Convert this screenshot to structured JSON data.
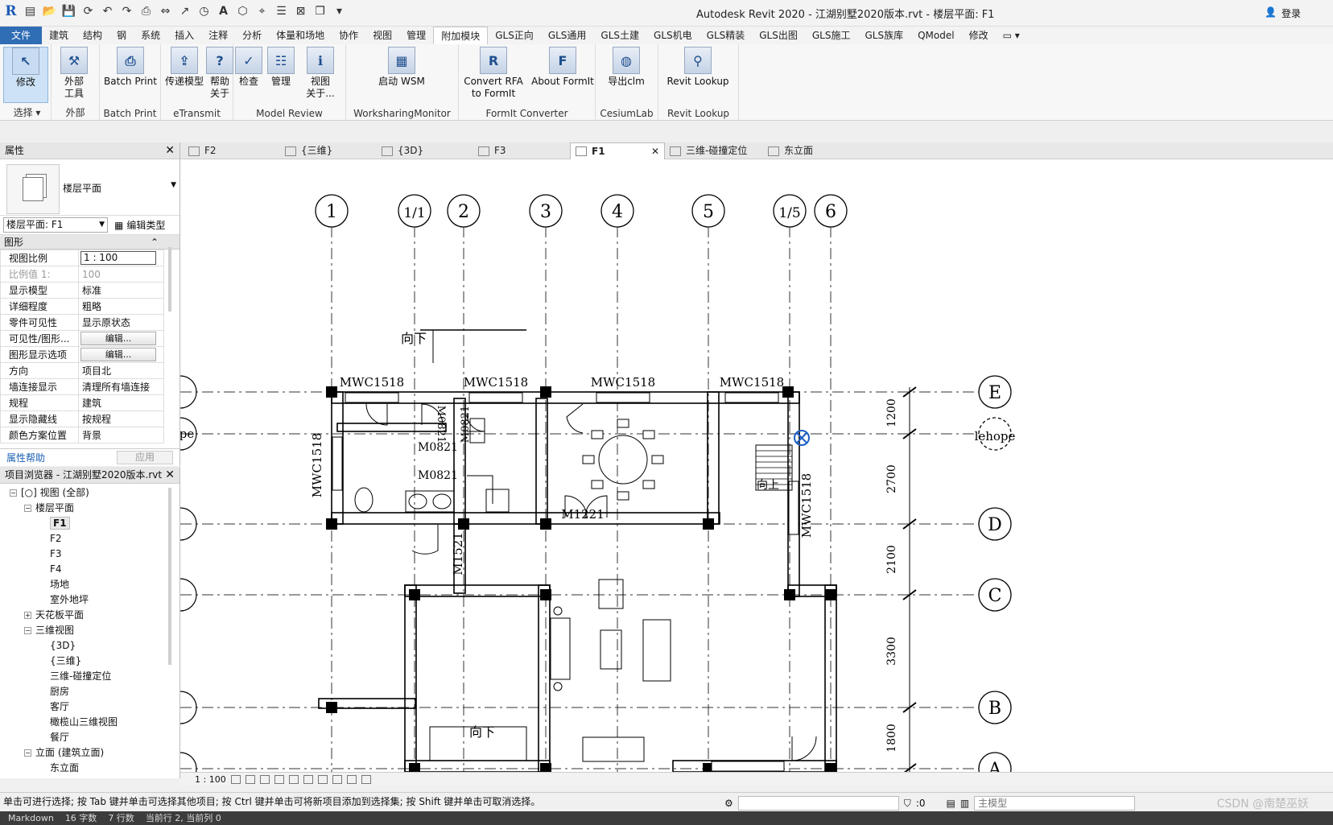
{
  "app": {
    "title": "Autodesk Revit 2020 - 江湖别墅2020版本.rvt - 楼层平面: F1",
    "signin": "登录",
    "logo": "R"
  },
  "menu": [
    "文件",
    "建筑",
    "结构",
    "钢",
    "系统",
    "插入",
    "注释",
    "分析",
    "体量和场地",
    "协作",
    "视图",
    "管理",
    "附加模块",
    "GLS正向",
    "GLS通用",
    "GLS土建",
    "GLS机电",
    "GLS精装",
    "GLS出图",
    "GLS施工",
    "GLS族库",
    "QModel",
    "修改"
  ],
  "menu_active": "附加模块",
  "ribbon": {
    "groups": [
      {
        "title": "选择 ▾",
        "buttons": [
          {
            "label": "修改",
            "icon": "cursor-icon"
          }
        ]
      },
      {
        "title": "外部",
        "buttons": [
          {
            "label": "外部\n工具",
            "icon": "tools-icon"
          }
        ]
      },
      {
        "title": "Batch Print",
        "buttons": [
          {
            "label": "Batch Print",
            "icon": "printer-icon"
          }
        ]
      },
      {
        "title": "eTransmit",
        "buttons": [
          {
            "label": "传递模型",
            "icon": "transmit-icon"
          },
          {
            "label": "帮助\n关于",
            "icon": "help-icon"
          }
        ]
      },
      {
        "title": "Model Review",
        "buttons": [
          {
            "label": "检查",
            "icon": "check-icon"
          },
          {
            "label": "管理",
            "icon": "manage-icon"
          },
          {
            "label": "视图\n关于...",
            "icon": "about-icon"
          }
        ]
      },
      {
        "title": "WorksharingMonitor",
        "buttons": [
          {
            "label": "启动 WSM",
            "icon": "wsm-icon"
          }
        ]
      },
      {
        "title": "FormIt Converter",
        "buttons": [
          {
            "label": "Convert RFA\nto FormIt",
            "icon": "rfa-icon"
          },
          {
            "label": "About FormIt",
            "icon": "formit-icon"
          }
        ]
      },
      {
        "title": "CesiumLab",
        "buttons": [
          {
            "label": "导出clm",
            "icon": "cesium-icon"
          }
        ]
      },
      {
        "title": "Revit Lookup",
        "buttons": [
          {
            "label": "Revit Lookup",
            "icon": "lookup-icon"
          }
        ]
      }
    ]
  },
  "view_tabs": [
    {
      "label": "F2"
    },
    {
      "label": "{三维}"
    },
    {
      "label": "{3D}"
    },
    {
      "label": "F3"
    },
    {
      "label": "F1"
    },
    {
      "label": "三维-碰撞定位"
    },
    {
      "label": "东立面"
    }
  ],
  "view_tab_active": "F1",
  "properties": {
    "title": "属性",
    "type_label": "楼层平面",
    "selector": "楼层平面: F1",
    "edit_type": "编辑类型",
    "section": "图形",
    "rows": [
      {
        "k": "视图比例",
        "v": "1 : 100"
      },
      {
        "k": "比例值 1:",
        "v": "100"
      },
      {
        "k": "显示模型",
        "v": "标准"
      },
      {
        "k": "详细程度",
        "v": "粗略"
      },
      {
        "k": "零件可见性",
        "v": "显示原状态"
      },
      {
        "k": "可见性/图形...",
        "v": "编辑..."
      },
      {
        "k": "图形显示选项",
        "v": "编辑..."
      },
      {
        "k": "方向",
        "v": "项目北"
      },
      {
        "k": "墙连接显示",
        "v": "清理所有墙连接"
      },
      {
        "k": "规程",
        "v": "建筑"
      },
      {
        "k": "显示隐藏线",
        "v": "按规程"
      },
      {
        "k": "颜色方案位置",
        "v": "背景"
      }
    ],
    "help": "属性帮助",
    "apply": "应用"
  },
  "browser": {
    "title": "项目浏览器 - 江湖别墅2020版本.rvt",
    "nodes": [
      {
        "l": 0,
        "t": "-",
        "label": "[○] 视图 (全部)"
      },
      {
        "l": 1,
        "t": "-",
        "label": "楼层平面"
      },
      {
        "l": 2,
        "t": "",
        "label": "F1",
        "bold": true
      },
      {
        "l": 2,
        "t": "",
        "label": "F2"
      },
      {
        "l": 2,
        "t": "",
        "label": "F3"
      },
      {
        "l": 2,
        "t": "",
        "label": "F4"
      },
      {
        "l": 2,
        "t": "",
        "label": "场地"
      },
      {
        "l": 2,
        "t": "",
        "label": "室外地坪"
      },
      {
        "l": 1,
        "t": "+",
        "label": "天花板平面"
      },
      {
        "l": 1,
        "t": "-",
        "label": "三维视图"
      },
      {
        "l": 2,
        "t": "",
        "label": "{3D}"
      },
      {
        "l": 2,
        "t": "",
        "label": "{三维}"
      },
      {
        "l": 2,
        "t": "",
        "label": "三维-碰撞定位"
      },
      {
        "l": 2,
        "t": "",
        "label": "厨房"
      },
      {
        "l": 2,
        "t": "",
        "label": "客厅"
      },
      {
        "l": 2,
        "t": "",
        "label": "橄榄山三维视图"
      },
      {
        "l": 2,
        "t": "",
        "label": "餐厅"
      },
      {
        "l": 1,
        "t": "-",
        "label": "立面 (建筑立面)"
      },
      {
        "l": 2,
        "t": "",
        "label": "东立面"
      }
    ]
  },
  "drawing": {
    "grid_columns": [
      "1",
      "1/1",
      "2",
      "3",
      "4",
      "5",
      "1/5",
      "6"
    ],
    "grid_rows": [
      "E",
      "lehope",
      "D",
      "C",
      "B",
      "A"
    ],
    "left_label": "pe",
    "dimensions": [
      "1200",
      "2700",
      "2100",
      "3300",
      "1800"
    ],
    "window_tags": [
      "MWC1518",
      "MWC1518",
      "MWC1518",
      "MWC1518",
      "MWC1518",
      "MWC1518"
    ],
    "door_tags": [
      "M0821",
      "M0821",
      "M0821",
      "M0821",
      "M1221",
      "M1521"
    ],
    "stair_labels": [
      "向下",
      "向上",
      "向下"
    ]
  },
  "view_control": {
    "scale": "1 : 100"
  },
  "status": {
    "text": "单击可进行选择; 按 Tab 键并单击可选择其他项目; 按 Ctrl 键并单击可将新项目添加到选择集; 按 Shift 键并单击可取消选择。",
    "zero": ":0",
    "model": "主模型"
  },
  "bottom": {
    "items": [
      "Markdown",
      "16 字数",
      "7 行数",
      "当前行 2, 当前列 0"
    ]
  },
  "watermark": "CSDN @南楚巫妖"
}
